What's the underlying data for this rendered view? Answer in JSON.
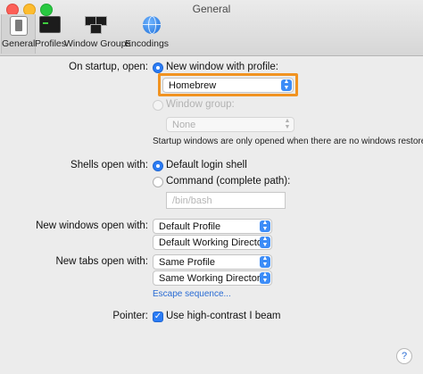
{
  "window": {
    "title": "General"
  },
  "toolbar": {
    "tabs": [
      {
        "label": "General",
        "icon": "general-icon",
        "active": true
      },
      {
        "label": "Profiles",
        "icon": "profiles-icon"
      },
      {
        "label": "Window Groups",
        "icon": "window-groups-icon"
      },
      {
        "label": "Encodings",
        "icon": "encodings-icon"
      }
    ]
  },
  "startup": {
    "label": "On startup, open:",
    "option_profile": "New window with profile:",
    "profile_value": "Homebrew",
    "option_group": "Window group:",
    "group_value": "None",
    "note": "Startup windows are only opened when there are no windows restored."
  },
  "shells": {
    "label": "Shells open with:",
    "option_default": "Default login shell",
    "option_command": "Command (complete path):",
    "command_placeholder": "/bin/bash"
  },
  "new_windows": {
    "label": "New windows open with:",
    "profile_value": "Default Profile",
    "directory_value": "Default Working Directory"
  },
  "new_tabs": {
    "label": "New tabs open with:",
    "profile_value": "Same Profile",
    "directory_value": "Same Working Directory",
    "escape_link": "Escape sequence..."
  },
  "pointer": {
    "label": "Pointer:",
    "option": "Use high-contrast I beam"
  },
  "help": {
    "glyph": "?"
  },
  "colors": {
    "accent": "#2b7cf5",
    "highlight": "#f19321"
  }
}
